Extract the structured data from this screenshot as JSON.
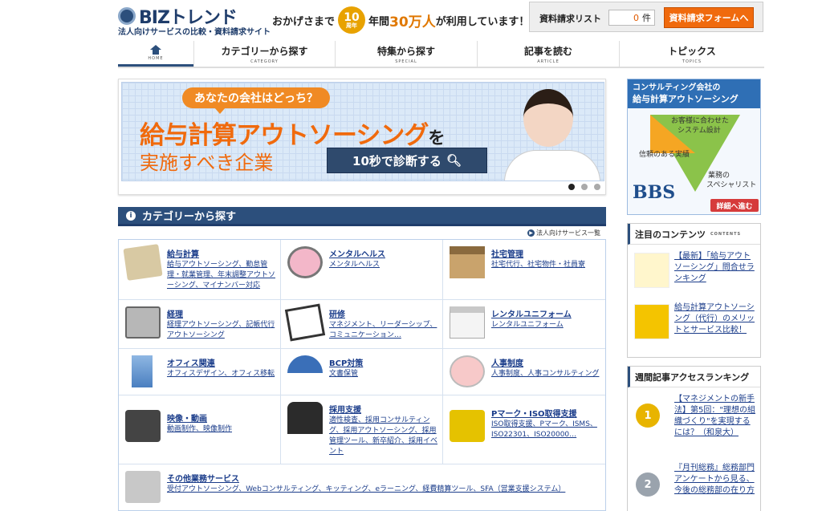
{
  "header": {
    "logo_text": "BIZトレンド",
    "tagline": "法人向けサービスの比較・資料請求サイト",
    "promo": {
      "prefix": "おかげさまで",
      "badge_num": "10",
      "badge_unit": "周年",
      "mid": "年間",
      "big": "30万人",
      "suffix": "が利用しています！"
    },
    "request_list_label": "資料請求リスト",
    "request_count": "0",
    "request_count_unit": "件",
    "request_form_button": "資料請求フォームへ"
  },
  "nav": [
    {
      "label": "",
      "en": "HOME"
    },
    {
      "label": "カテゴリーから探す",
      "en": "CATEGORY"
    },
    {
      "label": "特集から探す",
      "en": "SPECIAL"
    },
    {
      "label": "記事を読む",
      "en": "ARTICLE"
    },
    {
      "label": "トピックス",
      "en": "TOPICS"
    }
  ],
  "banner": {
    "bubble": "あなたの会社はどっち？",
    "title": "給与計算アウトソーシング",
    "title_suffix": "を",
    "subtitle": "実施すべき企業",
    "cta": "10秒で診断する"
  },
  "category_section": {
    "title": "カテゴリーから探す",
    "more_link": "法人向けサービス一覧",
    "cells": [
      {
        "name": "給与計算",
        "sub": "給与アウトソーシング、勤怠管理・就業管理、年末調整アウトソーシング、マイナンバー対応"
      },
      {
        "name": "メンタルヘルス",
        "sub": "メンタルヘルス"
      },
      {
        "name": "社宅管理",
        "sub": "社宅代行、社宅物件・社員寮"
      },
      {
        "name": "経理",
        "sub": "経理アウトソーシング、記帳代行アウトソーシング"
      },
      {
        "name": "研修",
        "sub": "マネジメント、リーダーシップ、コミュニケーション…"
      },
      {
        "name": "レンタルユニフォーム",
        "sub": "レンタルユニフォーム"
      },
      {
        "name": "オフィス関連",
        "sub": "オフィスデザイン、オフィス移転"
      },
      {
        "name": "BCP対策",
        "sub": "文書保管"
      },
      {
        "name": "人事制度",
        "sub": "人事制度、人事コンサルティング"
      },
      {
        "name": "映像・動画",
        "sub": "動画制作、映像制作"
      },
      {
        "name": "採用支援",
        "sub": "適性検査、採用コンサルティング、採用アウトソーシング、採用管理ツール、新卒紹介、採用イベント"
      },
      {
        "name": "Pマーク・ISO取得支援",
        "sub": "ISO取得支援、Pマーク、ISMS、ISO22301、ISO20000…"
      },
      {
        "name": "その他業務サービス",
        "sub": "受付アウトソーシング、Webコンサルティング、キッティング、eラーニング、経費精算ツール、SFA（営業支援システム）"
      }
    ]
  },
  "side_ad": {
    "line1": "コンサルティング会社の",
    "line2": "給与計算アウトソーシング",
    "t1": "お客様に合わせた",
    "t2": "システム設計",
    "t3": "信頼のある実績",
    "t4": "業務の",
    "t5": "スペシャリスト",
    "brand": "BBS",
    "button": "詳細へ進む"
  },
  "featured": {
    "title": "注目のコンテンツ",
    "en": "CONTENTS",
    "items": [
      {
        "text": "【最新】「給与アウトソーシング」問合せランキング"
      },
      {
        "text": "給与計算アウトソーシング（代行）のメリットとサービス比較！"
      }
    ]
  },
  "ranking": {
    "title": "週間記事アクセスランキング",
    "items": [
      {
        "rank": "1",
        "text": "【マネジメントの新手法】第5回：\"理想の組織づくり\"を実現するには？（和泉大）"
      },
      {
        "rank": "2",
        "text": "『月刊総務』総務部門アンケートから見る、今後の総務部の在り方"
      }
    ]
  },
  "colors": {
    "brand": "#2c4f7c",
    "accent": "#f06a0d",
    "link": "#1a3c8a"
  }
}
